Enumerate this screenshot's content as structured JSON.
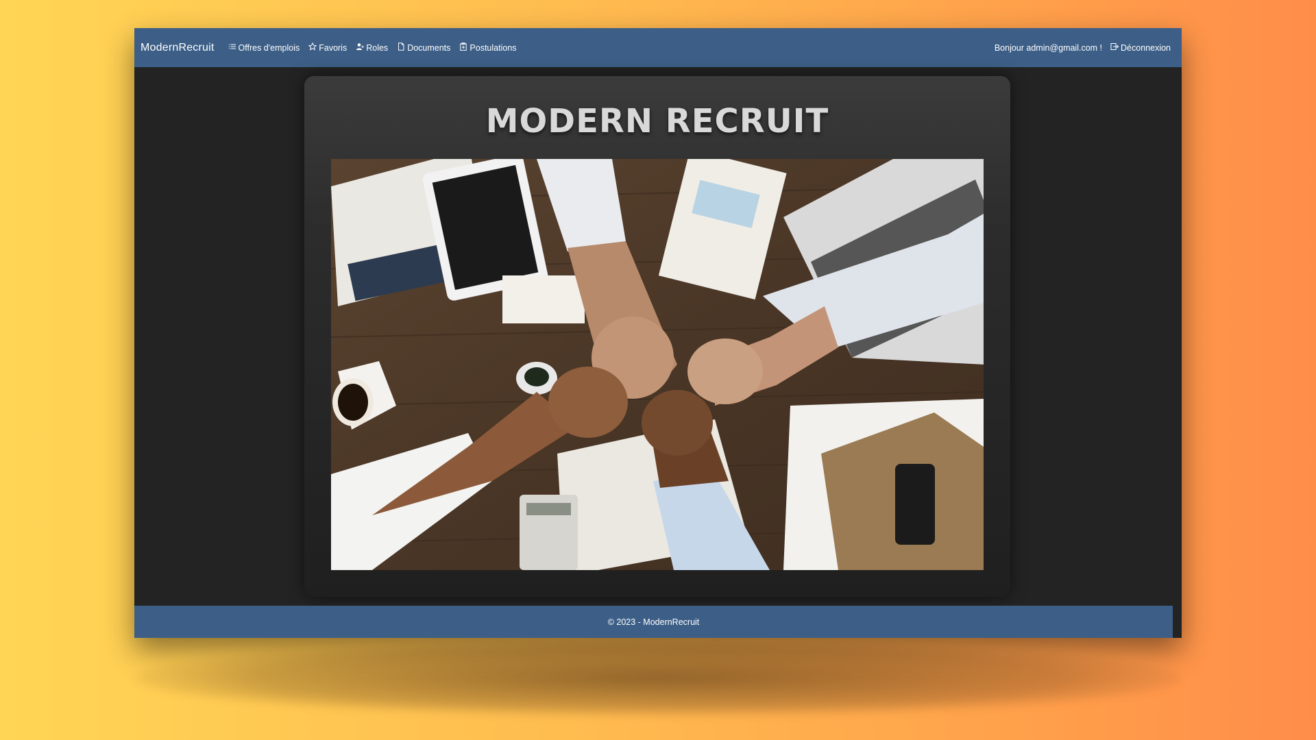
{
  "navbar": {
    "brand": "ModernRecruit",
    "links": [
      {
        "label": "Offres d'emplois",
        "icon": "list-icon"
      },
      {
        "label": "Favoris",
        "icon": "star-icon"
      },
      {
        "label": "Roles",
        "icon": "user-plus-icon"
      },
      {
        "label": "Documents",
        "icon": "document-icon"
      },
      {
        "label": "Postulations",
        "icon": "clipboard-icon"
      }
    ],
    "greeting": "Bonjour admin@gmail.com !",
    "logout": {
      "label": "Déconnexion",
      "icon": "logout-icon"
    }
  },
  "hero": {
    "title": "MODERN RECRUIT",
    "image": "team-fist-bump-photo"
  },
  "footer": {
    "text": "© 2023 - ModernRecruit"
  },
  "colors": {
    "navbar": "#3d5f87",
    "page_background": "#232323",
    "title": "#d9d9d9"
  }
}
